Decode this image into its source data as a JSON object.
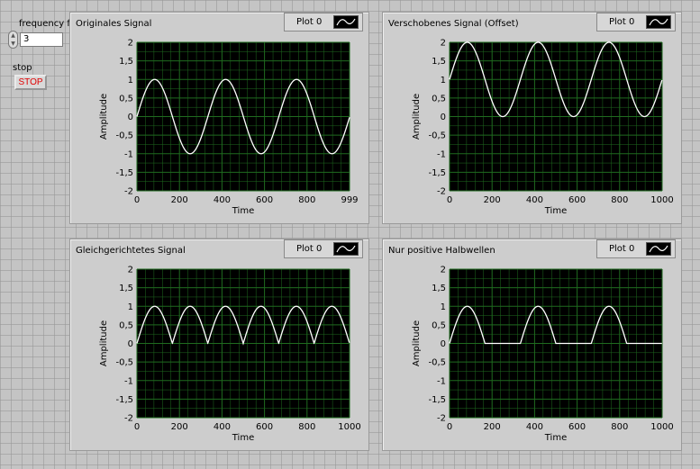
{
  "controls": {
    "frequency_label": "frequency f",
    "frequency_value": "3",
    "stop_label": "stop",
    "stop_button": "STOP"
  },
  "colors": {
    "plot_bg": "#000000",
    "grid": "#1f6b1f",
    "trace": "#ffffff"
  },
  "graphs": [
    {
      "title": "Originales Signal",
      "legend": "Plot 0",
      "ylabel": "Amplitude",
      "xlabel": "Time",
      "x_ticks": [
        "0",
        "200",
        "400",
        "600",
        "800",
        "999"
      ],
      "y_ticks": [
        "2",
        "1,5",
        "1",
        "0,5",
        "0",
        "-0,5",
        "-1",
        "-1,5",
        "-2"
      ],
      "chart_data": {
        "type": "line",
        "signal": "sine",
        "frequency_cycles": 3,
        "samples": 1000,
        "offset": 0,
        "xlim": [
          0,
          999
        ],
        "ylim": [
          -2,
          2
        ]
      }
    },
    {
      "title": "Verschobenes Signal (Offset)",
      "legend": "Plot 0",
      "ylabel": "Amplitude",
      "xlabel": "Time",
      "x_ticks": [
        "0",
        "200",
        "400",
        "600",
        "800",
        "1000"
      ],
      "y_ticks": [
        "2",
        "1,5",
        "1",
        "0,5",
        "0",
        "-0,5",
        "-1",
        "-1,5",
        "-2"
      ],
      "chart_data": {
        "type": "line",
        "signal": "sine",
        "frequency_cycles": 3,
        "samples": 1000,
        "offset": 1,
        "xlim": [
          0,
          1000
        ],
        "ylim": [
          -2,
          2
        ]
      }
    },
    {
      "title": "Gleichgerichtetes Signal",
      "legend": "Plot 0",
      "ylabel": "Amplitude",
      "xlabel": "Time",
      "x_ticks": [
        "0",
        "200",
        "400",
        "600",
        "800",
        "1000"
      ],
      "y_ticks": [
        "2",
        "1,5",
        "1",
        "0,5",
        "0",
        "-0,5",
        "-1",
        "-1,5",
        "-2"
      ],
      "chart_data": {
        "type": "line",
        "signal": "abs_sine",
        "frequency_cycles": 3,
        "samples": 1000,
        "offset": 0,
        "xlim": [
          0,
          1000
        ],
        "ylim": [
          -2,
          2
        ]
      }
    },
    {
      "title": "Nur positive Halbwellen",
      "legend": "Plot 0",
      "ylabel": "Amplitude",
      "xlabel": "Time",
      "x_ticks": [
        "0",
        "200",
        "400",
        "600",
        "800",
        "1000"
      ],
      "y_ticks": [
        "2",
        "1,5",
        "1",
        "0,5",
        "0",
        "-0,5",
        "-1",
        "-1,5",
        "-2"
      ],
      "chart_data": {
        "type": "line",
        "signal": "half_wave_sine",
        "frequency_cycles": 3,
        "samples": 1000,
        "offset": 0,
        "xlim": [
          0,
          1000
        ],
        "ylim": [
          -2,
          2
        ]
      }
    }
  ]
}
